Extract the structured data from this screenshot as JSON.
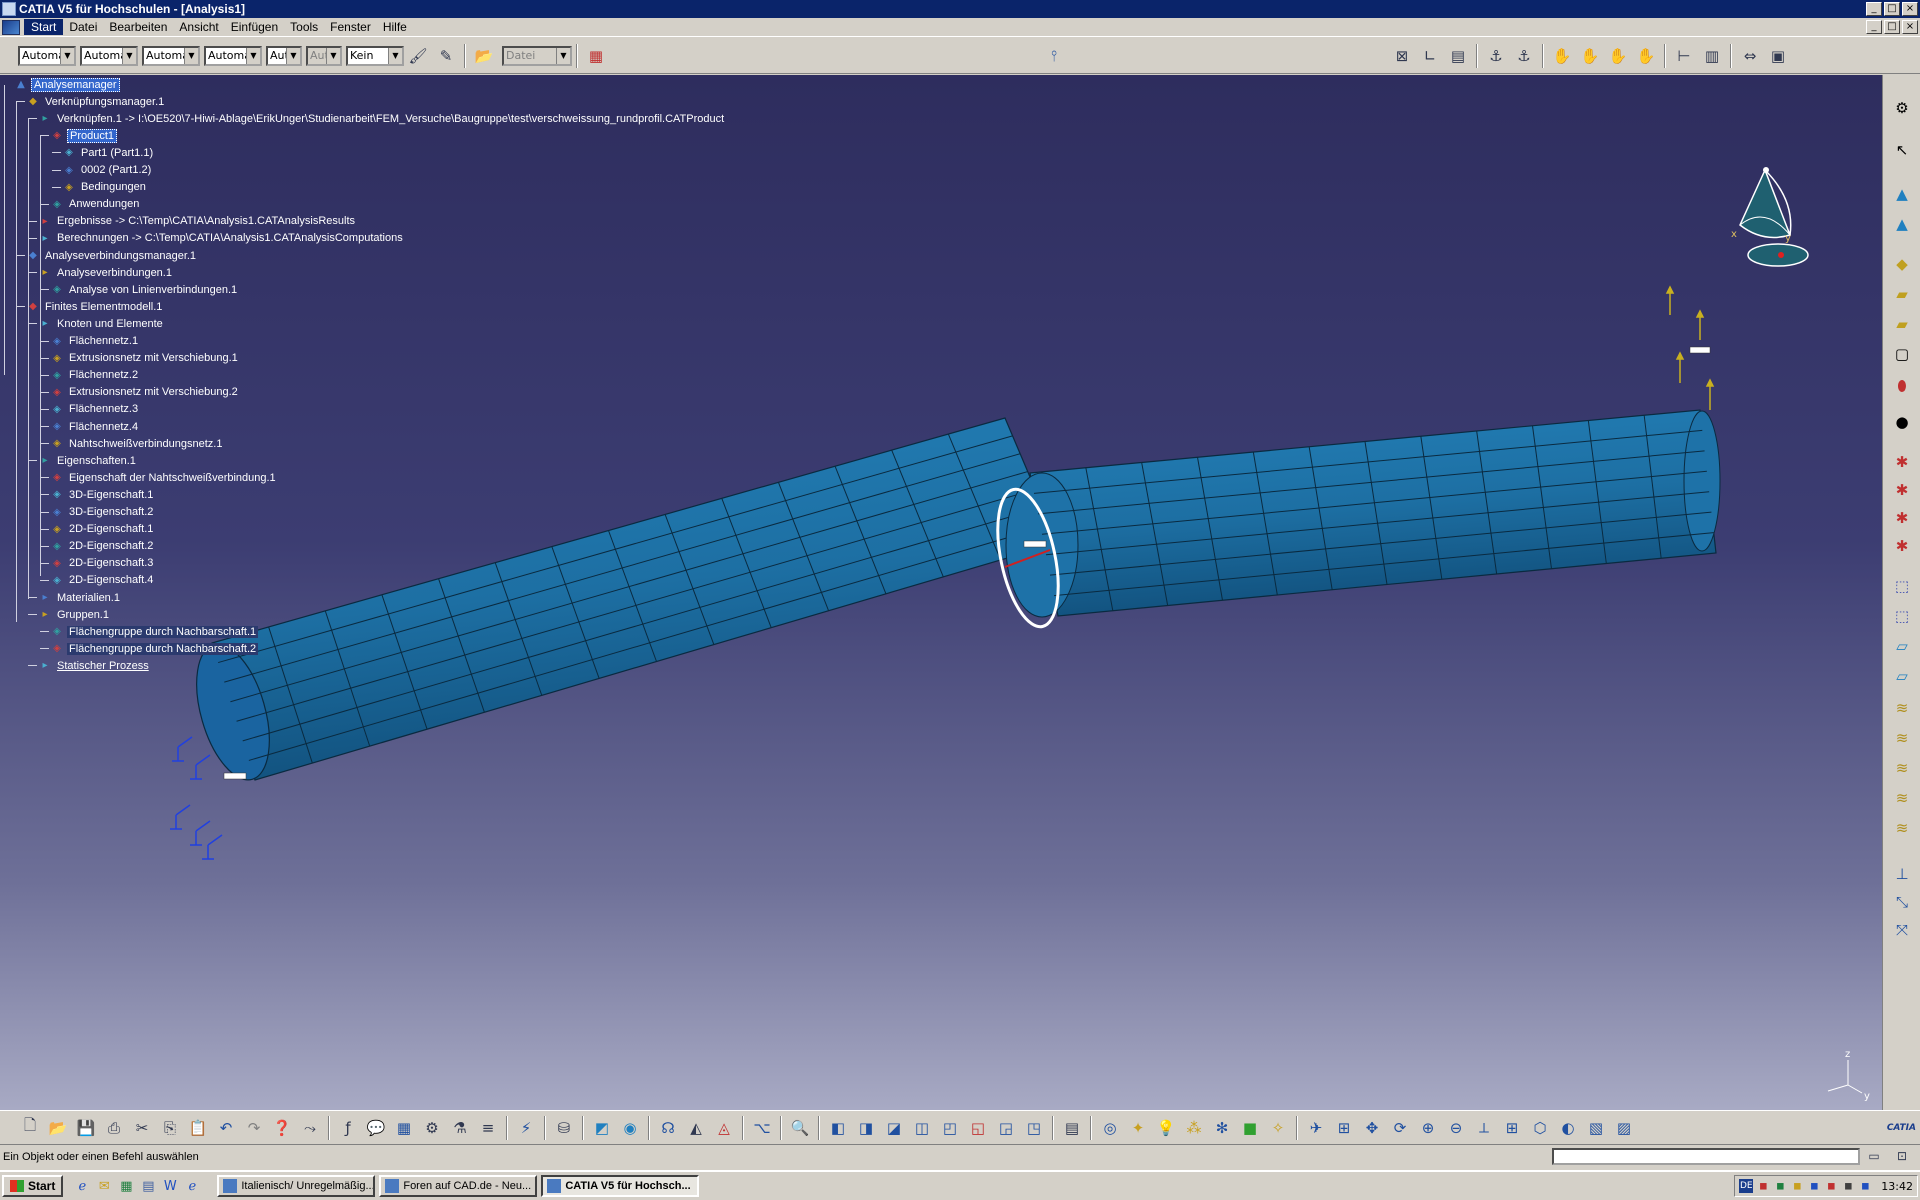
{
  "window": {
    "title": "CATIA V5 für Hochschulen - [Analysis1]",
    "buttons": {
      "minimize": "_",
      "maximize": "□",
      "close": "×"
    }
  },
  "menu": {
    "items": [
      "Start",
      "Datei",
      "Bearbeiten",
      "Ansicht",
      "Einfügen",
      "Tools",
      "Fenster",
      "Hilfe"
    ],
    "active_index": 0
  },
  "toolbar_top": {
    "combos": [
      {
        "value": "Automa",
        "disabled": false
      },
      {
        "value": "Automa",
        "disabled": false
      },
      {
        "value": "Automa",
        "disabled": false
      },
      {
        "value": "Automa",
        "disabled": false
      },
      {
        "value": "Aut",
        "disabled": false
      },
      {
        "value": "Aut",
        "disabled": true
      },
      {
        "value": "Kein",
        "disabled": false
      }
    ],
    "file_combo": {
      "value": "Datei",
      "disabled": true
    }
  },
  "spec_tree": {
    "nodes": [
      {
        "label": "Analysemanager",
        "level": 0,
        "style": "sel"
      },
      {
        "label": "Verknüpfungsmanager.1",
        "level": 1,
        "style": ""
      },
      {
        "label": "Verknüpfen.1 -> I:\\OE520\\7-Hiwi-Ablage\\ErikUnger\\Studienarbeit\\FEM_Versuche\\Baugruppe\\test\\verschweissung_rundprofil.CATProduct",
        "level": 2,
        "style": ""
      },
      {
        "label": "Product1",
        "level": 3,
        "style": "sel"
      },
      {
        "label": "Part1 (Part1.1)",
        "level": 4,
        "style": ""
      },
      {
        "label": "0002 (Part1.2)",
        "level": 4,
        "style": ""
      },
      {
        "label": "Bedingungen",
        "level": 4,
        "style": ""
      },
      {
        "label": "Anwendungen",
        "level": 3,
        "style": ""
      },
      {
        "label": "Ergebnisse -> C:\\Temp\\CATIA\\Analysis1.CATAnalysisResults",
        "level": 2,
        "style": ""
      },
      {
        "label": "Berechnungen -> C:\\Temp\\CATIA\\Analysis1.CATAnalysisComputations",
        "level": 2,
        "style": ""
      },
      {
        "label": "Analyseverbindungsmanager.1",
        "level": 1,
        "style": ""
      },
      {
        "label": "Analyseverbindungen.1",
        "level": 2,
        "style": ""
      },
      {
        "label": "Analyse von Linienverbindungen.1",
        "level": 3,
        "style": ""
      },
      {
        "label": "Finites Elementmodell.1",
        "level": 1,
        "style": ""
      },
      {
        "label": "Knoten und Elemente",
        "level": 2,
        "style": ""
      },
      {
        "label": "Flächennetz.1",
        "level": 3,
        "style": ""
      },
      {
        "label": "Extrusionsnetz mit Verschiebung.1",
        "level": 3,
        "style": ""
      },
      {
        "label": "Flächennetz.2",
        "level": 3,
        "style": ""
      },
      {
        "label": "Extrusionsnetz mit Verschiebung.2",
        "level": 3,
        "style": ""
      },
      {
        "label": "Flächennetz.3",
        "level": 3,
        "style": ""
      },
      {
        "label": "Flächennetz.4",
        "level": 3,
        "style": ""
      },
      {
        "label": "Nahtschweißverbindungsnetz.1",
        "level": 3,
        "style": ""
      },
      {
        "label": "Eigenschaften.1",
        "level": 2,
        "style": ""
      },
      {
        "label": "Eigenschaft der Nahtschweißverbindung.1",
        "level": 3,
        "style": ""
      },
      {
        "label": "3D-Eigenschaft.1",
        "level": 3,
        "style": ""
      },
      {
        "label": "3D-Eigenschaft.2",
        "level": 3,
        "style": ""
      },
      {
        "label": "2D-Eigenschaft.1",
        "level": 3,
        "style": ""
      },
      {
        "label": "2D-Eigenschaft.2",
        "level": 3,
        "style": ""
      },
      {
        "label": "2D-Eigenschaft.3",
        "level": 3,
        "style": ""
      },
      {
        "label": "2D-Eigenschaft.4",
        "level": 3,
        "style": ""
      },
      {
        "label": "Materialien.1",
        "level": 2,
        "style": ""
      },
      {
        "label": "Gruppen.1",
        "level": 2,
        "style": ""
      },
      {
        "label": "Flächengruppe durch Nachbarschaft.1",
        "level": 3,
        "style": "hl"
      },
      {
        "label": "Flächengruppe durch Nachbarschaft.2",
        "level": 3,
        "style": "hl"
      },
      {
        "label": "Statischer Prozess",
        "level": 2,
        "style": "ul"
      }
    ]
  },
  "axis_labels": {
    "x": "x",
    "y": "y",
    "z": "z"
  },
  "model_colors": {
    "tube": "#1d6fa3",
    "tube_dark": "#145580",
    "mesh": "#0a2a40",
    "weld": "#ffffff"
  },
  "status": {
    "text": "Ein Objekt oder einen Befehl auswählen"
  },
  "taskbar": {
    "start_label": "Start",
    "tasks": [
      {
        "label": "Italienisch/ Unregelmäßig...",
        "active": false
      },
      {
        "label": "Foren auf CAD.de - Neu...",
        "active": false
      },
      {
        "label": "CATIA V5 für Hochsch...",
        "active": true
      }
    ],
    "tray": {
      "lang": "DE",
      "clock": "13:42"
    }
  },
  "logo_text": "CATIA"
}
